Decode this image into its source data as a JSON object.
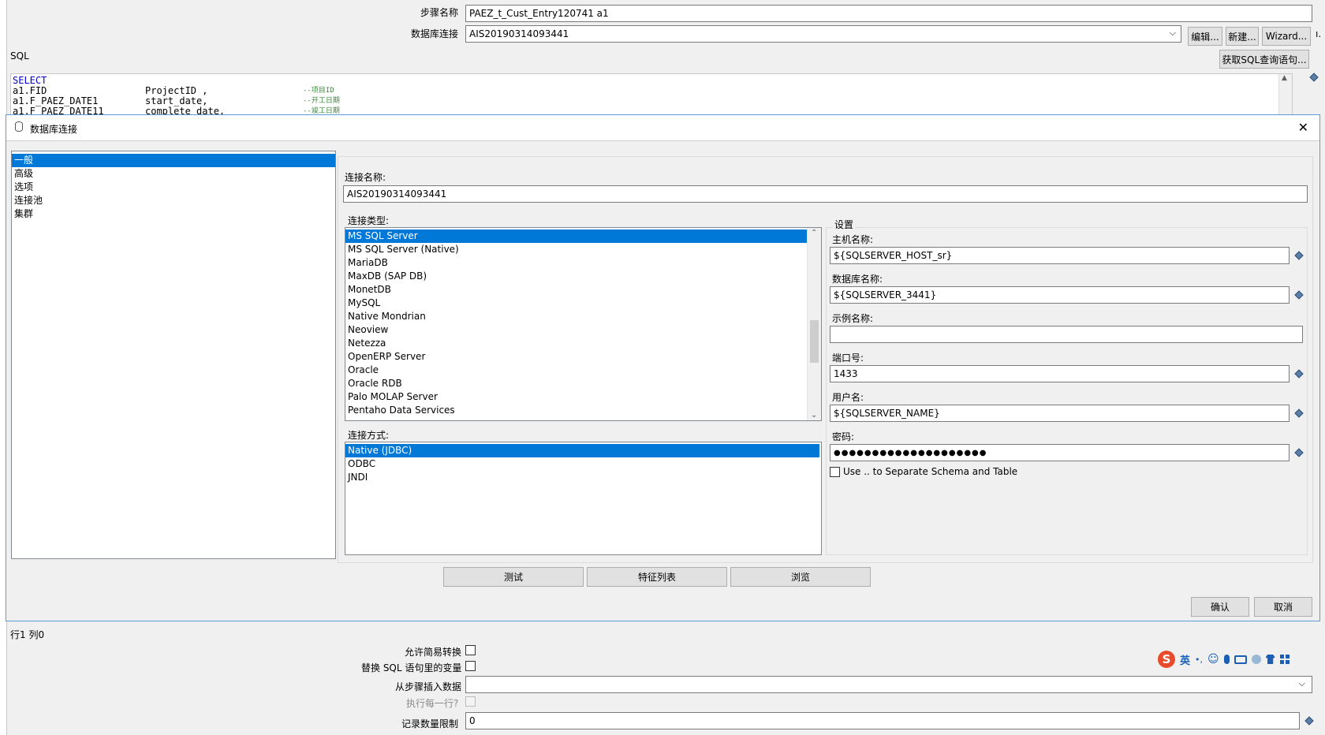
{
  "step": {
    "name_label": "步骤名称",
    "name_value": "PAEZ_t_Cust_Entry120741 a1",
    "db_label": "数据库连接",
    "db_value": "AIS20190314093441",
    "edit_btn": "编辑...",
    "new_btn": "新建...",
    "wizard_btn": "Wizard...",
    "sql_label": "SQL",
    "get_sql_btn": "获取SQL查询语句..."
  },
  "sql_lines": [
    {
      "code": "SELECT",
      "alias": "",
      "comment": ""
    },
    {
      "code": "a1.FID",
      "alias": "ProjectID ,",
      "comment": "--项目ID"
    },
    {
      "code": "a1.F_PAEZ_DATE1",
      "alias": "start_date,",
      "comment": "--开工日期"
    },
    {
      "code": "a1.F_PAEZ_DATE11",
      "alias": "complete date,",
      "comment": "--竣工日期"
    }
  ],
  "dialog": {
    "title": "数据库连接",
    "close": "✕",
    "nav": [
      "一般",
      "高级",
      "选项",
      "连接池",
      "集群"
    ],
    "conn_name_label": "连接名称:",
    "conn_name_value": "AIS20190314093441",
    "conn_type_label": "连接类型:",
    "conn_types": [
      "MS SQL Server",
      "MS SQL Server (Native)",
      "MariaDB",
      "MaxDB (SAP DB)",
      "MonetDB",
      "MySQL",
      "Native Mondrian",
      "Neoview",
      "Netezza",
      "OpenERP Server",
      "Oracle",
      "Oracle RDB",
      "Palo MOLAP Server",
      "Pentaho Data Services"
    ],
    "access_label": "连接方式:",
    "access_types": [
      "Native (JDBC)",
      "ODBC",
      "JNDI"
    ],
    "settings_label": "设置",
    "host_label": "主机名称:",
    "host_value": "${SQLSERVER_HOST_sr}",
    "dbname_label": "数据库名称:",
    "dbname_value": "${SQLSERVER_3441}",
    "instance_label": "示例名称:",
    "instance_value": "",
    "port_label": "端口号:",
    "port_value": "1433",
    "user_label": "用户名:",
    "user_value": "${SQLSERVER_NAME}",
    "password_label": "密码:",
    "password_value": "●●●●●●●●●●●●●●●●●●●●",
    "schema_check_label": "Use .. to Separate Schema and Table",
    "test_btn": "测试",
    "features_btn": "特征列表",
    "explore_btn": "浏览",
    "ok_btn": "确认",
    "cancel_btn": "取消"
  },
  "bottom": {
    "position": "行1 列0",
    "lazy_label": "允许简易转换",
    "replace_label": "替换 SQL 语句里的变量",
    "insert_label": "从步骤插入数据",
    "insert_value": "",
    "each_row_label": "执行每一行?",
    "limit_label": "记录数量限制",
    "limit_value": "0"
  },
  "ime": {
    "lang": "英",
    "punct": "•,",
    "logo": "S"
  }
}
